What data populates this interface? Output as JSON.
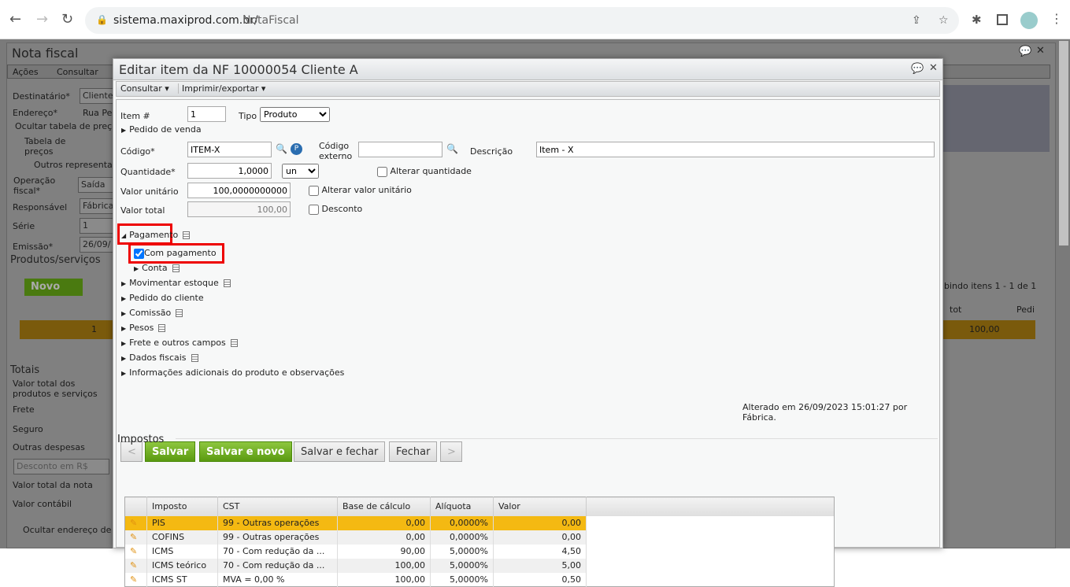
{
  "browser": {
    "url_host": "sistema.maxiprod.com.br/",
    "url_path": "NotaFiscal"
  },
  "bg": {
    "title": "Nota fiscal",
    "menu": [
      "Ações",
      "Consultar"
    ],
    "labels": [
      "Destinatário*",
      "Endereço*",
      "Ocultar tabela de preços",
      "Tabela de preços",
      "Outros representantes",
      "Operação fiscal*",
      "Responsável",
      "Série",
      "Emissão*"
    ],
    "values": [
      "Cliente",
      "Rua Pe",
      "Saída",
      "Fábrica",
      "1",
      "26/09/"
    ],
    "products_title": "Produtos/serviços",
    "novo": "Novo",
    "paging": "bindo itens 1 - 1 de 1",
    "col_tot": "tot",
    "col_ped": "Pedi",
    "row_num": "1",
    "row_total": "100,00",
    "totals_title": "Totais",
    "totals": [
      "Valor total dos produtos e serviços",
      "Frete",
      "Seguro",
      "Outras despesas"
    ],
    "desconto": "Desconto em R$",
    "totals2": [
      "Valor total da nota",
      "Valor contábil"
    ],
    "ocultar_endereco": "Ocultar endereço de"
  },
  "modal": {
    "title": "Editar item da NF 10000054 Cliente A",
    "toolbar": [
      "Consultar",
      "Imprimir/exportar"
    ],
    "item_label": "Item #",
    "item_value": "1",
    "tipo_label": "Tipo",
    "tipo_value": "Produto",
    "pedido_venda": "Pedido de venda",
    "codigo_label": "Código*",
    "codigo_value": "ITEM-X",
    "codigo_externo_label": "Código externo",
    "codigo_externo_value": "",
    "descricao_label": "Descrição",
    "descricao_value": "Item - X",
    "quantidade_label": "Quantidade*",
    "quantidade_value": "1,0000",
    "unit": "un",
    "alterar_quantidade": "Alterar quantidade",
    "valor_unitario_label": "Valor unitário",
    "valor_unitario_value": "100,0000000000",
    "alterar_valor_unitario": "Alterar valor unitário",
    "valor_total_label": "Valor total",
    "valor_total_value": "100,00",
    "desconto": "Desconto",
    "pagamento": "Pagamento",
    "com_pagamento": "Com pagamento",
    "conta": "Conta",
    "sections": [
      "Movimentar estoque",
      "Pedido do cliente",
      "Comissão",
      "Pesos",
      "Frete e outros campos",
      "Dados fiscais",
      "Informações adicionais do produto e observações"
    ],
    "buttons": {
      "prev": "<",
      "salvar": "Salvar",
      "salvar_novo": "Salvar e novo",
      "salvar_fechar": "Salvar e fechar",
      "fechar": "Fechar",
      "next": ">"
    },
    "altered": "Alterado em 26/09/2023 15:01:27 por Fábrica.",
    "impostos_title": "Impostos",
    "tax_headers": [
      "Imposto",
      "CST",
      "Base de cálculo",
      "Alíquota",
      "Valor"
    ],
    "tax_rows": [
      {
        "imposto": "PIS",
        "cst": "99 - Outras operações",
        "base": "0,00",
        "aliquota": "0,0000%",
        "valor": "0,00"
      },
      {
        "imposto": "COFINS",
        "cst": "99 - Outras operações",
        "base": "0,00",
        "aliquota": "0,0000%",
        "valor": "0,00"
      },
      {
        "imposto": "ICMS",
        "cst": "70 - Com redução da ...",
        "base": "90,00",
        "aliquota": "5,0000%",
        "valor": "4,50"
      },
      {
        "imposto": "ICMS teórico",
        "cst": "70 - Com redução da ...",
        "base": "100,00",
        "aliquota": "5,0000%",
        "valor": "5,00"
      },
      {
        "imposto": "ICMS ST",
        "cst": "MVA = 0,00 %",
        "base": "100,00",
        "aliquota": "5,0000%",
        "valor": "0,50"
      }
    ]
  }
}
